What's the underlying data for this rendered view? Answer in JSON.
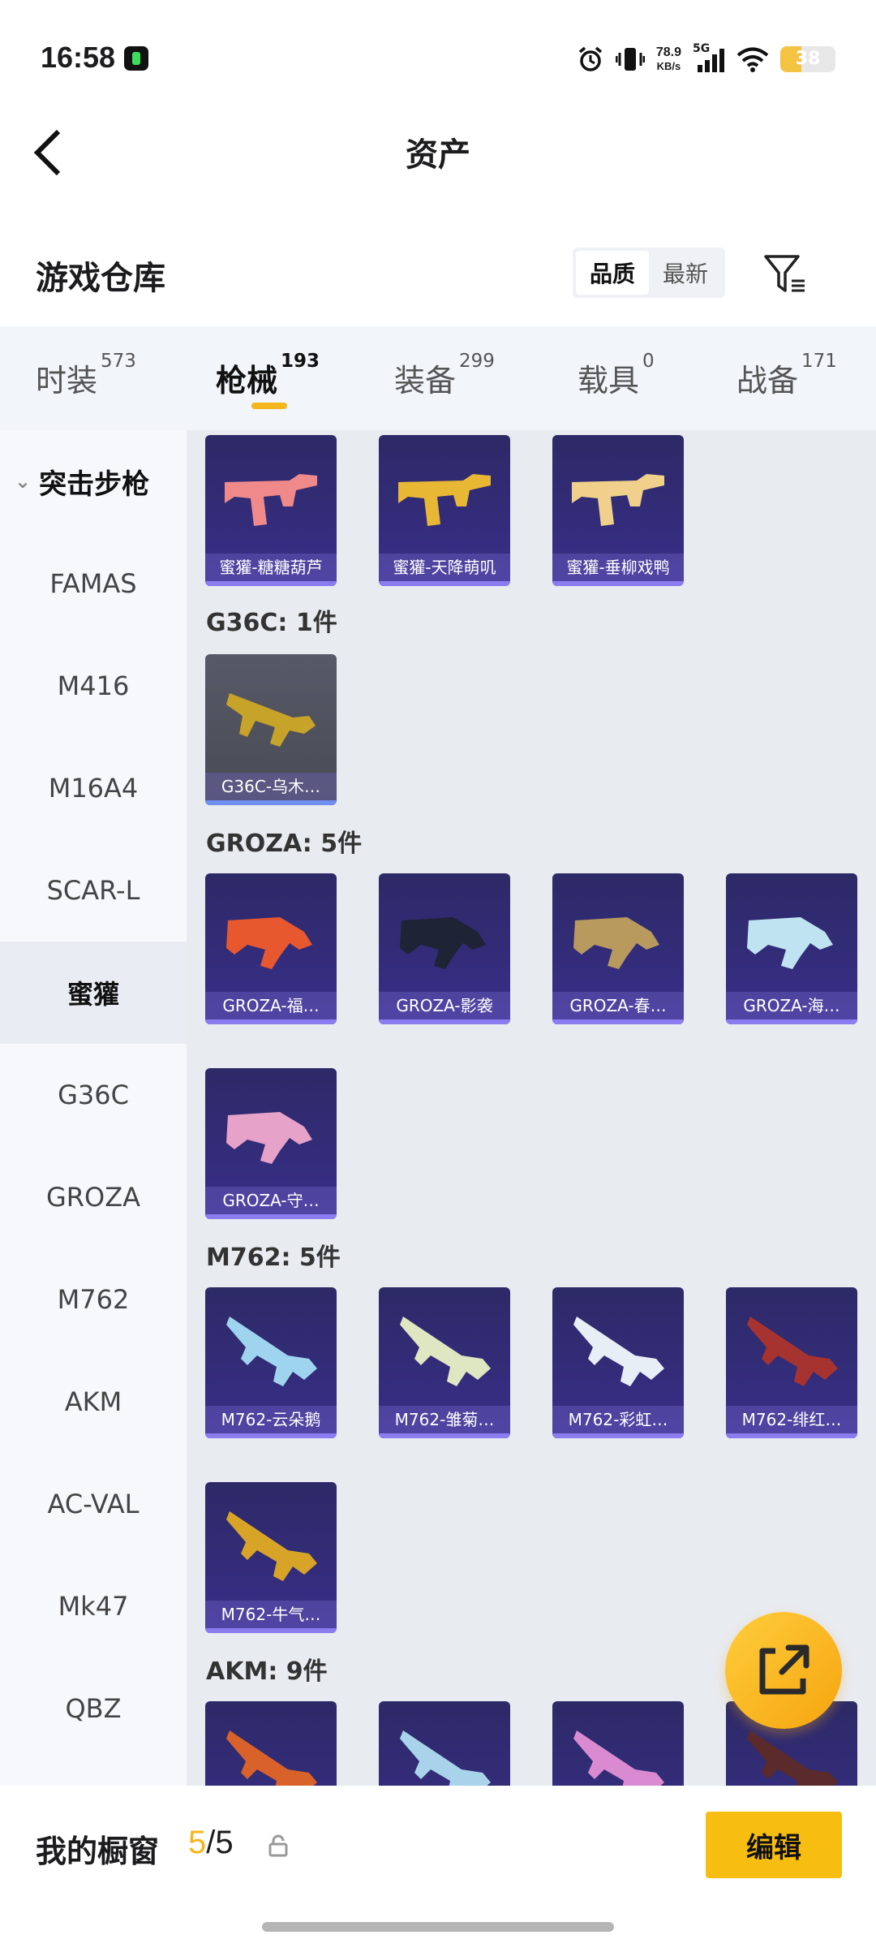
{
  "status_bar": {
    "time": "16:58",
    "net_speed_value": "78.9",
    "net_speed_unit": "KB/s",
    "network_type": "5G",
    "battery_level": "38",
    "icons": [
      "alarm-icon",
      "vibrate-icon",
      "signal-icon",
      "wifi-icon",
      "battery-icon"
    ]
  },
  "header": {
    "title": "资产"
  },
  "section": {
    "title": "游戏仓库",
    "sort_options": [
      "品质",
      "最新"
    ],
    "active_sort": "品质"
  },
  "tabs": [
    {
      "label": "时装",
      "count": "573",
      "active": false
    },
    {
      "label": "枪械",
      "count": "193",
      "active": true
    },
    {
      "label": "装备",
      "count": "299",
      "active": false
    },
    {
      "label": "载具",
      "count": "0",
      "active": false
    },
    {
      "label": "战备",
      "count": "171",
      "active": false
    }
  ],
  "sidebar": {
    "group": "突击步枪",
    "items": [
      {
        "label": "FAMAS",
        "active": false
      },
      {
        "label": "M416",
        "active": false
      },
      {
        "label": "M16A4",
        "active": false
      },
      {
        "label": "SCAR-L",
        "active": false
      },
      {
        "label": "蜜獾",
        "active": true
      },
      {
        "label": "G36C",
        "active": false
      },
      {
        "label": "GROZA",
        "active": false
      },
      {
        "label": "M762",
        "active": false
      },
      {
        "label": "AKM",
        "active": false
      },
      {
        "label": "AC-VAL",
        "active": false
      },
      {
        "label": "Mk47",
        "active": false
      },
      {
        "label": "QBZ",
        "active": false
      }
    ]
  },
  "content": {
    "sections": [
      {
        "heading": "",
        "items": [
          "蜜獾-糖糖葫芦",
          "蜜獾-天降萌叽",
          "蜜獾-垂柳戏鸭"
        ]
      },
      {
        "heading": "G36C: 1件",
        "items": [
          "G36C-乌木…"
        ]
      },
      {
        "heading": "GROZA: 5件",
        "items": [
          "GROZA-福…",
          "GROZA-影袭",
          "GROZA-春…",
          "GROZA-海…",
          "GROZA-守…"
        ]
      },
      {
        "heading": "M762: 5件",
        "items": [
          "M762-云朵鹅",
          "M762-雏菊…",
          "M762-彩虹…",
          "M762-绯红…",
          "M762-牛气…"
        ]
      },
      {
        "heading": "AKM: 9件",
        "items": []
      }
    ]
  },
  "bottom_bar": {
    "showcase_label": "我的橱窗",
    "showcase_current": "5",
    "showcase_separator": "/",
    "showcase_total": "5",
    "edit_label": "编辑"
  },
  "colors": {
    "accent": "#f5b51c",
    "card_bg": "#2f2b6f",
    "card_stripe": "#8b7cf0"
  }
}
